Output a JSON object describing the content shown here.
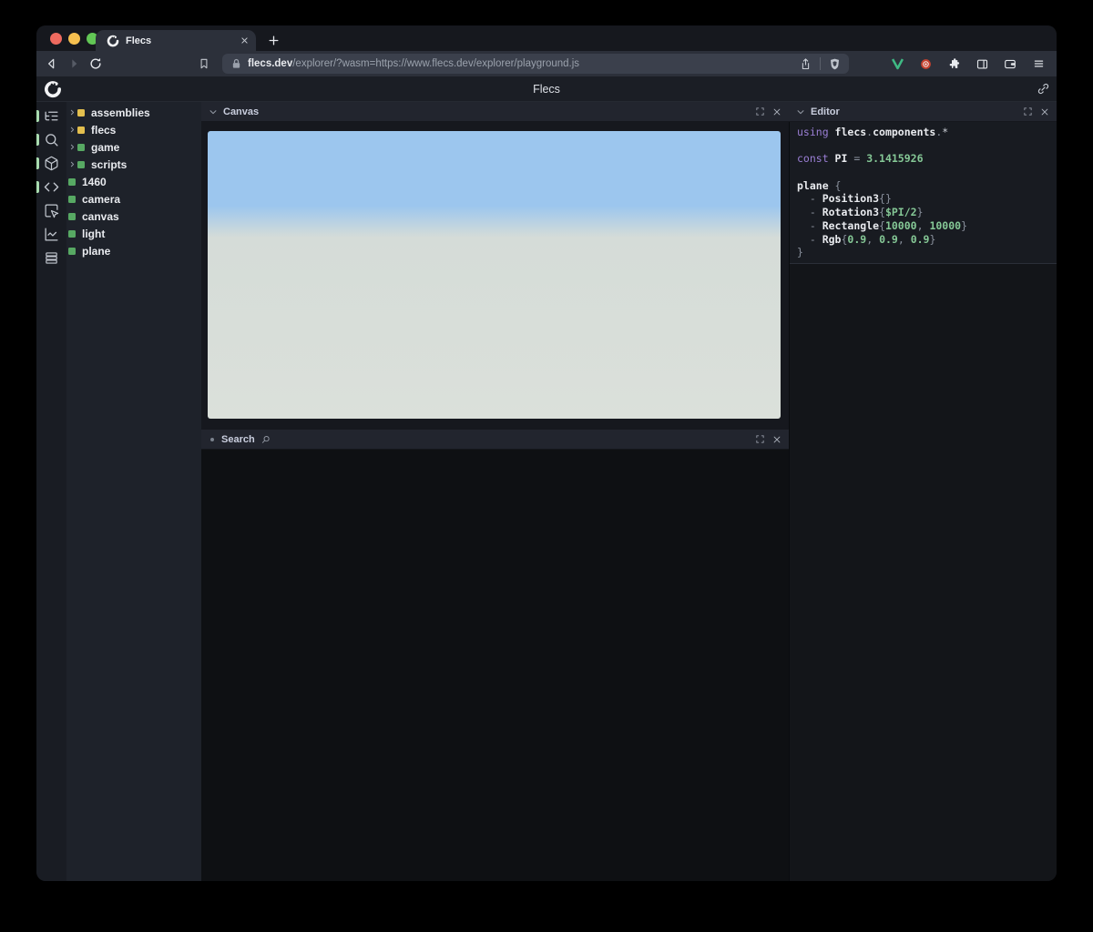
{
  "browser": {
    "tab": {
      "title": "Flecs"
    },
    "url": {
      "domain": "flecs.dev",
      "rest": "/explorer/?wasm=https://www.flecs.dev/explorer/playground.js"
    },
    "toolbar_icons": [
      "back",
      "forward",
      "reload",
      "bookmark",
      "lock",
      "share",
      "brave-shield",
      "vue-devtools",
      "extension",
      "puzzle",
      "sidebar-toggle",
      "wallet",
      "menu"
    ]
  },
  "app": {
    "header": {
      "title": "Flecs",
      "icons": [
        "flecs-logo",
        "link"
      ]
    }
  },
  "sidebar": {
    "items": [
      {
        "name": "entity-tree",
        "active": true
      },
      {
        "name": "search",
        "active": true
      },
      {
        "name": "scene",
        "active": true
      },
      {
        "name": "code",
        "active": true
      },
      {
        "name": "inspect",
        "active": false
      },
      {
        "name": "stats",
        "active": false
      },
      {
        "name": "queries",
        "active": false
      }
    ]
  },
  "tree": {
    "items": [
      {
        "label": "assemblies",
        "color": "yellow",
        "expandable": true
      },
      {
        "label": "flecs",
        "color": "yellow",
        "expandable": true
      },
      {
        "label": "game",
        "color": "green",
        "expandable": true
      },
      {
        "label": "scripts",
        "color": "green",
        "expandable": true
      },
      {
        "label": "1460",
        "color": "green",
        "expandable": false
      },
      {
        "label": "camera",
        "color": "green",
        "expandable": false
      },
      {
        "label": "canvas",
        "color": "green",
        "expandable": false
      },
      {
        "label": "light",
        "color": "green",
        "expandable": false
      },
      {
        "label": "plane",
        "color": "green",
        "expandable": false
      }
    ]
  },
  "panels": {
    "canvas": {
      "title": "Canvas",
      "sky_color": "#9cc6ee",
      "horizon_color": "#d5dcd8",
      "ground_color": "#dbe0da"
    },
    "search": {
      "title": "Search"
    },
    "editor": {
      "title": "Editor",
      "code": [
        [
          {
            "t": "using ",
            "c": "kw"
          },
          {
            "t": "flecs",
            "c": "id"
          },
          {
            "t": ".",
            "c": "p"
          },
          {
            "t": "components",
            "c": "id"
          },
          {
            "t": ".",
            "c": "p"
          },
          {
            "t": "*",
            "c": "pl"
          }
        ],
        [],
        [
          {
            "t": "const ",
            "c": "kw"
          },
          {
            "t": "PI",
            "c": "id"
          },
          {
            "t": " = ",
            "c": "p"
          },
          {
            "t": "3.1415926",
            "c": "num"
          }
        ],
        [],
        [
          {
            "t": "plane",
            "c": "id"
          },
          {
            "t": " {",
            "c": "p"
          }
        ],
        [
          {
            "t": "  - ",
            "c": "p"
          },
          {
            "t": "Position3",
            "c": "id"
          },
          {
            "t": "{}",
            "c": "p"
          }
        ],
        [
          {
            "t": "  - ",
            "c": "p"
          },
          {
            "t": "Rotation3",
            "c": "id"
          },
          {
            "t": "{",
            "c": "p"
          },
          {
            "t": "$PI/2",
            "c": "num"
          },
          {
            "t": "}",
            "c": "p"
          }
        ],
        [
          {
            "t": "  - ",
            "c": "p"
          },
          {
            "t": "Rectangle",
            "c": "id"
          },
          {
            "t": "{",
            "c": "p"
          },
          {
            "t": "10000",
            "c": "num"
          },
          {
            "t": ", ",
            "c": "p"
          },
          {
            "t": "10000",
            "c": "num"
          },
          {
            "t": "}",
            "c": "p"
          }
        ],
        [
          {
            "t": "  - ",
            "c": "p"
          },
          {
            "t": "Rgb",
            "c": "id"
          },
          {
            "t": "{",
            "c": "p"
          },
          {
            "t": "0.9",
            "c": "num"
          },
          {
            "t": ", ",
            "c": "p"
          },
          {
            "t": "0.9",
            "c": "num"
          },
          {
            "t": ", ",
            "c": "p"
          },
          {
            "t": "0.9",
            "c": "num"
          },
          {
            "t": "}",
            "c": "p"
          }
        ],
        [
          {
            "t": "}",
            "c": "p"
          }
        ]
      ]
    }
  },
  "colors": {
    "module_yellow": "#e3bf4e",
    "entity_green": "#57a963",
    "sidebar_indicator": "#a8dbaf",
    "traffic_red": "#ee6a5f",
    "traffic_yellow": "#f5bf4f",
    "traffic_green": "#62c655",
    "syntax_keyword": "#9b7fd6",
    "syntax_identifier": "#e9ebef",
    "syntax_number": "#85c896",
    "syntax_punct": "#8a919d"
  }
}
